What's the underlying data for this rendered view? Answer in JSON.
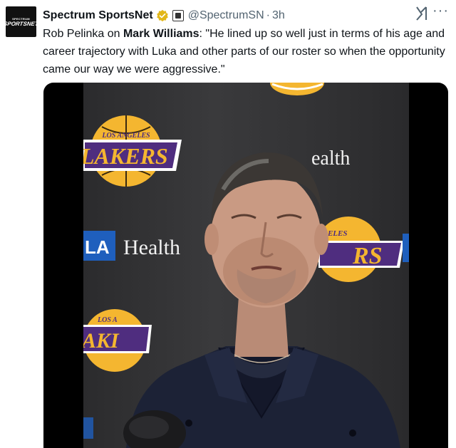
{
  "account": {
    "avatar_line1": "SPECTRUM",
    "avatar_line2": "SPORTSNET",
    "display_name": "Spectrum SportsNet",
    "handle": "@SpectrumSN",
    "separator": "·",
    "time": "3h",
    "verified_color": "#e2b719"
  },
  "actions": {
    "grok_icon": "grok-icon",
    "more_label": "···"
  },
  "tweet": {
    "prefix": "Rob Pelinka on ",
    "mention": "Mark Williams",
    "body": ": \"He lined up so well just in terms of his age and career trajectory with Luka and other parts of our roster so when the opportunity came our way we were aggressive.\""
  },
  "media": {
    "backdrop_logo_top": "LOS ANGELES",
    "backdrop_logo_main": "LAKERS",
    "backdrop_la": "LA",
    "backdrop_health": "Health",
    "backdrop_partial_health": "ealth",
    "backdrop_partial_top": "GELES",
    "backdrop_partial_main": "RS",
    "backdrop_partial_top2": "LOS A",
    "backdrop_partial_main2": "AKI",
    "colors": {
      "lakers_gold": "#f4b630",
      "lakers_purple": "#4f2d7f",
      "la_blue": "#1f5fbd"
    }
  }
}
